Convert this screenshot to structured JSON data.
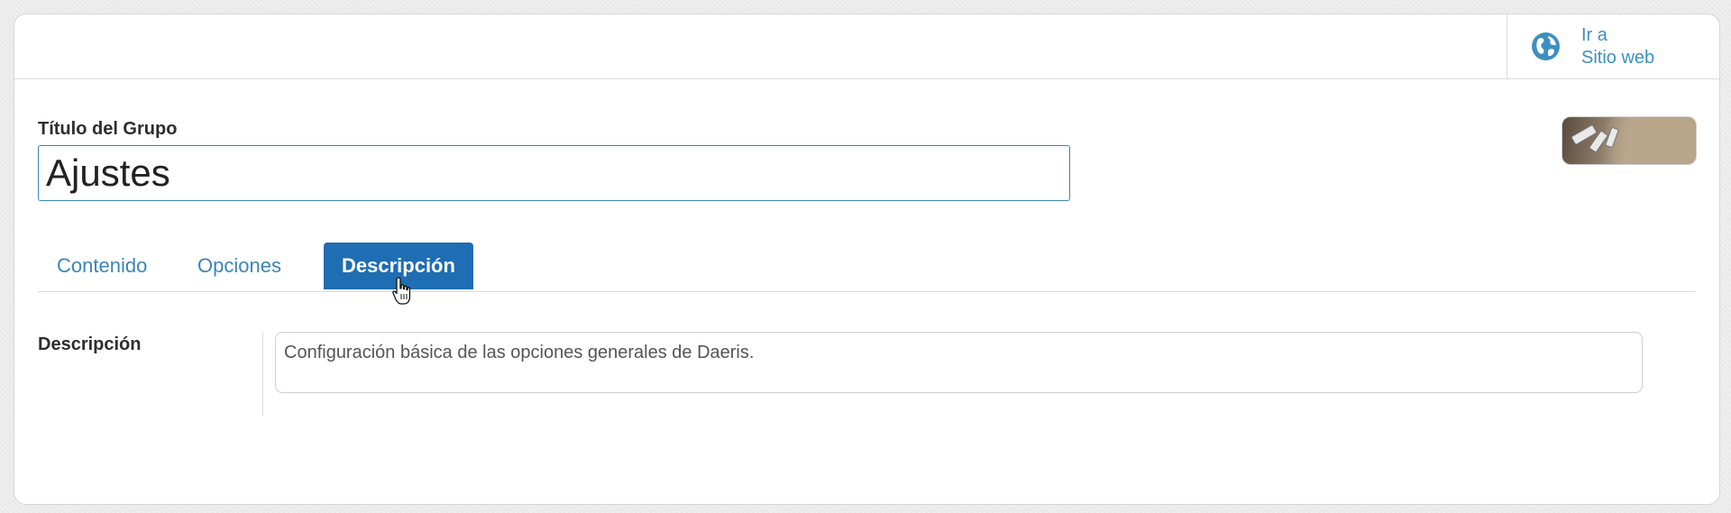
{
  "header": {
    "goto_site_line1": "Ir a",
    "goto_site_line2": "Sitio web",
    "goto_site_icon": "globe-icon",
    "accent_color": "#3d8fc2"
  },
  "form": {
    "title_label": "Título del Grupo",
    "title_value": "Ajustes",
    "thumbnail_icon": "group-image-thumbnail"
  },
  "tabs": [
    {
      "label": "Contenido",
      "active": false
    },
    {
      "label": "Opciones",
      "active": false
    },
    {
      "label": "Descripción",
      "active": true
    }
  ],
  "description": {
    "label": "Descripción",
    "value": "Configuración básica de las opciones generales de Daeris."
  },
  "colors": {
    "active_tab_bg": "#1f6db2",
    "tab_text": "#3d84b9",
    "input_border": "#3d84b9"
  }
}
